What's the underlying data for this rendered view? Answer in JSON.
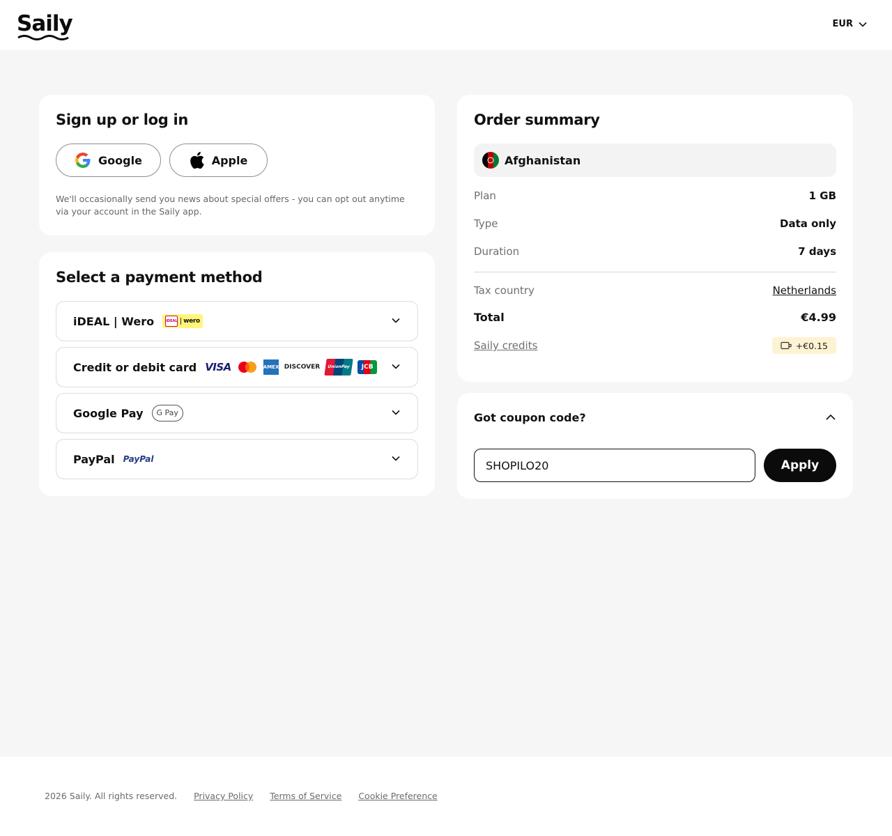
{
  "brand": {
    "name": "Saily"
  },
  "header": {
    "currency": "EUR"
  },
  "auth": {
    "title": "Sign up or log in",
    "google_label": "Google",
    "apple_label": "Apple",
    "disclaimer": "We'll occasionally send you news about special offers - you can opt out anytime via your account in the Saily app."
  },
  "payment": {
    "title": "Select a payment method",
    "options": [
      {
        "label": "iDEAL | Wero",
        "logos": [
          "iDEAL",
          "wero"
        ]
      },
      {
        "label": "Credit or debit card",
        "logos": [
          "VISA",
          "mastercard",
          "AMEX",
          "DISCOVER",
          "UnionPay",
          "JCB"
        ]
      },
      {
        "label": "Google Pay",
        "logos": [
          "G Pay"
        ]
      },
      {
        "label": "PayPal",
        "logos": [
          "PayPal"
        ]
      }
    ]
  },
  "summary": {
    "title": "Order summary",
    "country": "Afghanistan",
    "rows": [
      {
        "key": "Plan",
        "value": "1 GB"
      },
      {
        "key": "Type",
        "value": "Data only"
      },
      {
        "key": "Duration",
        "value": "7 days"
      }
    ],
    "tax_label": "Tax country",
    "tax_value": "Netherlands",
    "total_label": "Total",
    "total_value": "€4.99",
    "credits_label": "Saily credits",
    "credits_value": "+€0.15"
  },
  "coupon": {
    "title": "Got coupon code?",
    "value": "SHOPILO20",
    "apply_label": "Apply"
  },
  "footer": {
    "copyright": "2026 Saily. All rights reserved.",
    "links": [
      "Privacy Policy",
      "Terms of Service",
      "Cookie Preference"
    ]
  },
  "colors": {
    "accent": "#0b0b0b",
    "background": "#f6f6f6",
    "credits_badge": "#fdf3d2"
  }
}
